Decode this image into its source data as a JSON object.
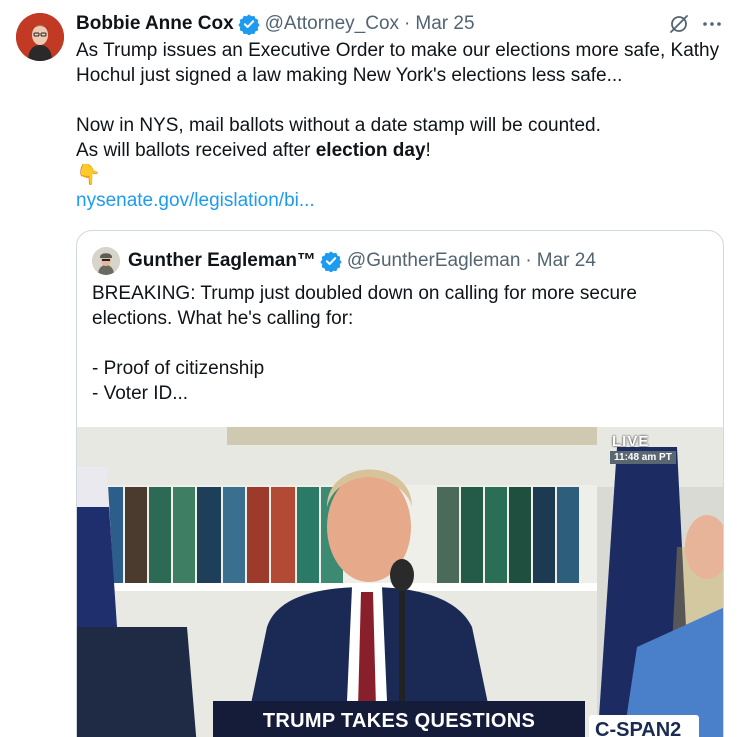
{
  "tweet": {
    "author_name": "Bobbie Anne Cox",
    "handle": "@Attorney_Cox",
    "separator": "·",
    "date": "Mar 25",
    "text": {
      "line1": "As Trump issues an Executive Order to make our elections more safe, Kathy Hochul just signed a law making New York's elections less safe...",
      "line2": "Now in NYS, mail ballots without a date stamp will be counted.",
      "line3_prefix": "As will ballots received after ",
      "line3_bold": "election day",
      "line3_suffix": "!",
      "emoji": "👇",
      "link": "nysenate.gov/legislation/bi..."
    },
    "icons": {
      "verified": "verified-badge-icon",
      "grok": "grok-icon",
      "more": "more-icon"
    },
    "colors": {
      "link": "#1d9bf0",
      "verified": "#1d9bf0",
      "secondary_text": "#536471",
      "border": "#cfd9de"
    }
  },
  "quote": {
    "author_name": "Gunther Eagleman™",
    "handle": "@GuntherEagleman",
    "separator": "·",
    "date": "Mar 24",
    "text": {
      "line1": "BREAKING: Trump just doubled down on calling for more secure elections. What he's calling for:",
      "line2": "- Proof of citizenship",
      "line3": "- Voter ID..."
    },
    "media": {
      "live_label": "LIVE",
      "live_time": "11:48 am PT",
      "chyron": "TRUMP TAKES QUESTIONS",
      "network": "C-SPAN2"
    }
  }
}
